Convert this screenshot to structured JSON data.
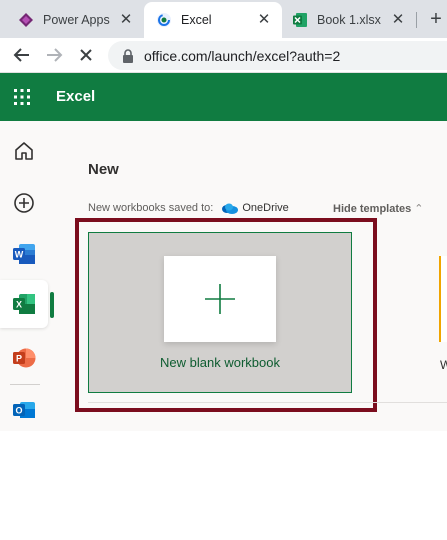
{
  "browser": {
    "tabs": [
      {
        "label": "Power Apps",
        "close": "✕"
      },
      {
        "label": "Excel",
        "close": "✕"
      },
      {
        "label": "Book 1.xlsx",
        "close": "✕"
      }
    ],
    "new_tab": "+",
    "url": "office.com/launch/excel?auth=2"
  },
  "app": {
    "name": "Excel",
    "brand_color": "#107c41"
  },
  "left_rail": {
    "items": [
      "home-icon",
      "add-icon",
      "word-icon",
      "excel-icon",
      "powerpoint-icon",
      "outlook-icon"
    ],
    "word_letter": "W",
    "excel_letter": "X",
    "powerpoint_letter": "P",
    "outlook_letter": "O"
  },
  "main": {
    "section_title": "New",
    "saved_to_label": "New workbooks saved to:",
    "saved_to_location": "OneDrive",
    "hide_templates": "Hide templates",
    "blank_workbook_label": "New blank workbook",
    "next_template_partial": "W"
  },
  "highlight_color": "#7b0d1e"
}
